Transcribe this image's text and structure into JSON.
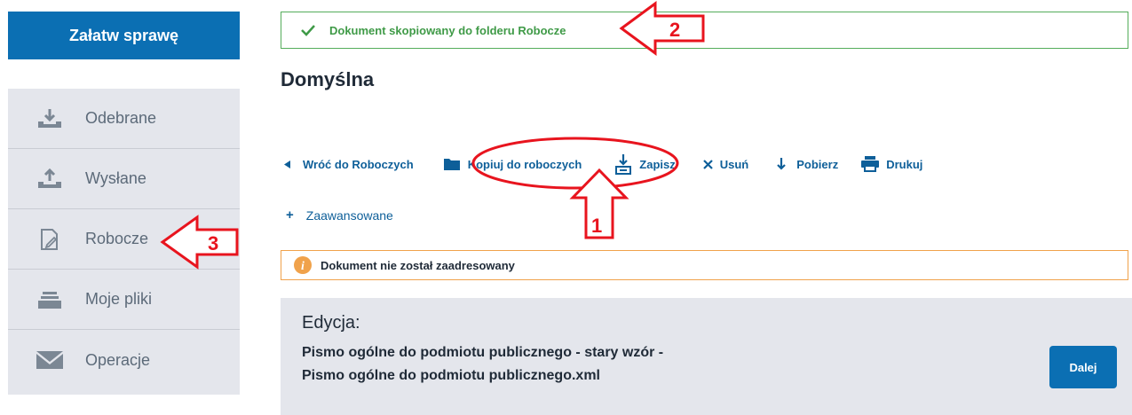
{
  "sidebar": {
    "primary_button": "Załatw sprawę",
    "items": [
      {
        "label": "Odebrane",
        "icon": "inbox-download-icon"
      },
      {
        "label": "Wysłane",
        "icon": "outbox-upload-icon"
      },
      {
        "label": "Robocze",
        "icon": "draft-edit-icon"
      },
      {
        "label": "Moje pliki",
        "icon": "tray-files-icon"
      },
      {
        "label": "Operacje",
        "icon": "envelope-icon"
      }
    ]
  },
  "alert_success": {
    "text": "Dokument skopiowany do folderu Robocze",
    "icon": "check-icon"
  },
  "page": {
    "title": "Domyślna"
  },
  "toolbar": {
    "back": "Wróć do Roboczych",
    "copy": "Kopiuj do roboczych",
    "save": "Zapisz",
    "delete": "Usuń",
    "download": "Pobierz",
    "print": "Drukuj"
  },
  "advanced": {
    "label": "Zaawansowane"
  },
  "alert_warning": {
    "text": "Dokument nie został zaadresowany",
    "icon": "info-icon"
  },
  "edit": {
    "label": "Edycja:",
    "filename": "Pismo ogólne do podmiotu publicznego - stary wzór - Pismo ogólne do podmiotu publicznego.xml",
    "next_button": "Dalej"
  },
  "annotations": {
    "n1": "1",
    "n2": "2",
    "n3": "3",
    "color": "#e8141e"
  },
  "colors": {
    "primary": "#0b6fb3",
    "success": "#3f9a47",
    "warning_border": "#f0a24b",
    "panel_bg": "#e4e6ec"
  }
}
